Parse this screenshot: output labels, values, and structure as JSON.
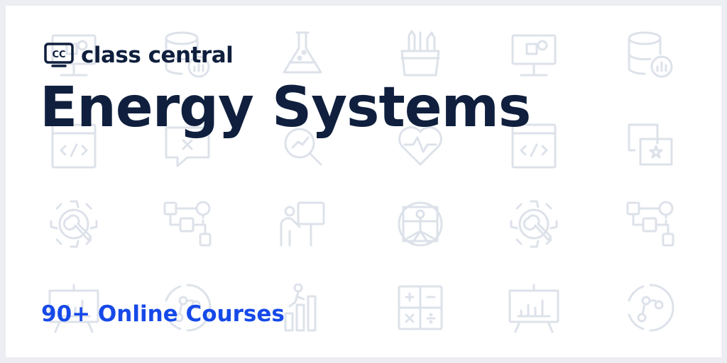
{
  "brand": {
    "name": "class central",
    "mark_text": "CC"
  },
  "title": "Energy Systems",
  "course_count_label": "90+ Online Courses",
  "colors": {
    "title": "#0f1f3d",
    "accent": "#1649e8",
    "pattern_stroke": "#dde2ea",
    "background": "#ffffff"
  },
  "background_icons": [
    "presentation-board-icon",
    "database-chart-icon",
    "flask-icon",
    "pencil-cup-icon",
    "presentation-board-icon",
    "database-chart-icon",
    "code-window-icon",
    "chat-bubble-icon",
    "magnifier-chart-icon",
    "heart-pulse-icon",
    "code-window-icon",
    "chat-star-icon",
    "gear-wrench-icon",
    "flowchart-icon",
    "teacher-board-icon",
    "vitruvian-man-icon",
    "gear-wrench-icon",
    "flowchart-icon",
    "chart-board-icon",
    "globe-network-icon",
    "career-growth-icon",
    "calculator-icon",
    "chart-board-icon",
    "globe-network-icon"
  ]
}
